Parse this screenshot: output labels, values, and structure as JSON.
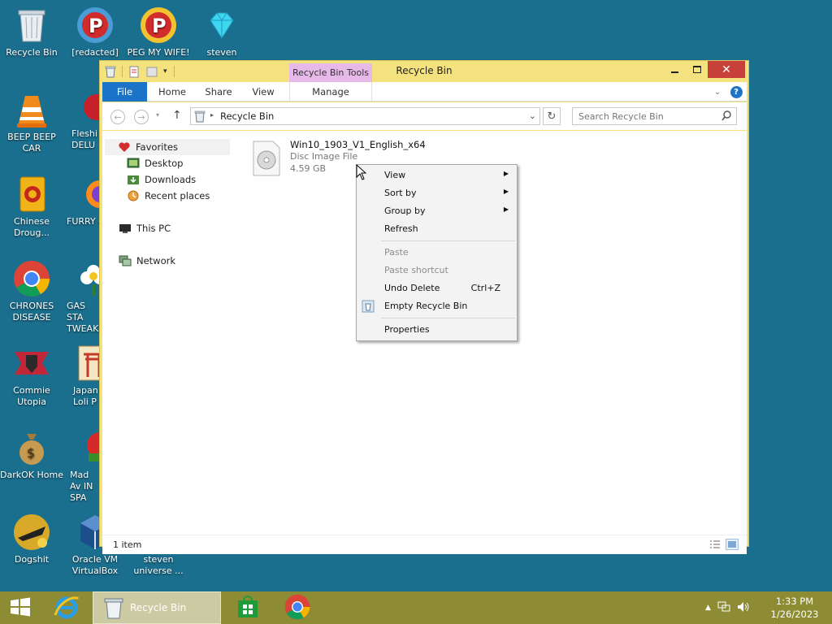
{
  "desktop_icons": [
    {
      "label": "Recycle Bin",
      "icon": "recycle-bin-icon"
    },
    {
      "label": "[redacted]",
      "icon": "peggle-icon"
    },
    {
      "label": "PEG MY WIFE!",
      "icon": "peggle-icon"
    },
    {
      "label": "steven",
      "icon": "diamond-icon"
    },
    {
      "label": "BEEP BEEP CAR",
      "icon": "vlc-icon"
    },
    {
      "label": "Fleshi DELU",
      "icon": "game-icon"
    },
    {
      "label": "Chinese Droug...",
      "icon": "mahjong-icon"
    },
    {
      "label": "FURRY C",
      "icon": "firefox-icon"
    },
    {
      "label": "CHRONES DISEASE",
      "icon": "chrome-icon"
    },
    {
      "label": "GAS STA TWEAK",
      "icon": "flower-icon"
    },
    {
      "label": "Commie Utopia",
      "icon": "shield-icon"
    },
    {
      "label": "Japan Loli P",
      "icon": "torii-icon"
    },
    {
      "label": "DarkOK Home",
      "icon": "money-bag-icon"
    },
    {
      "label": "Mad Av IN SPA",
      "icon": "angry-birds-icon"
    },
    {
      "label": "Dogshit",
      "icon": "dog-icon"
    },
    {
      "label": "Oracle VM VirtualBox",
      "icon": "virtualbox-icon"
    },
    {
      "label": "steven universe ...",
      "icon": "shortcut-icon"
    }
  ],
  "window": {
    "title": "Recycle Bin",
    "context_tab": "Recycle Bin Tools",
    "ribbon_tabs": [
      "File",
      "Home",
      "Share",
      "View",
      "Manage"
    ],
    "address": {
      "breadcrumb": "Recycle Bin"
    },
    "search": {
      "placeholder": "Search Recycle Bin"
    },
    "nav_pane": {
      "favorites": "Favorites",
      "favorites_items": [
        "Desktop",
        "Downloads",
        "Recent places"
      ],
      "this_pc": "This PC",
      "network": "Network"
    },
    "file": {
      "name": "Win10_1903_V1_English_x64",
      "type": "Disc Image File",
      "size": "4.59 GB"
    },
    "status": "1 item"
  },
  "context_menu": {
    "items": [
      {
        "label": "View",
        "submenu": true,
        "enabled": true
      },
      {
        "label": "Sort by",
        "submenu": true,
        "enabled": true
      },
      {
        "label": "Group by",
        "submenu": true,
        "enabled": true
      },
      {
        "label": "Refresh",
        "enabled": true
      },
      {
        "label": "Paste",
        "enabled": false
      },
      {
        "label": "Paste shortcut",
        "enabled": false
      },
      {
        "label": "Undo Delete",
        "shortcut": "Ctrl+Z",
        "enabled": true
      },
      {
        "label": "Empty Recycle Bin",
        "enabled": true,
        "icon": "recycle-bin-icon"
      },
      {
        "label": "Properties",
        "enabled": true
      }
    ]
  },
  "taskbar": {
    "active_task": "Recycle Bin",
    "clock": {
      "time": "1:33 PM",
      "date": "1/26/2023"
    }
  },
  "colors": {
    "desktop": "#1b6f8e",
    "window_frame": "#f4e27f",
    "taskbar": "#8d8b33",
    "file_tab": "#1b74c8",
    "close": "#c7413a",
    "context_tab": "#e7b9e8"
  }
}
